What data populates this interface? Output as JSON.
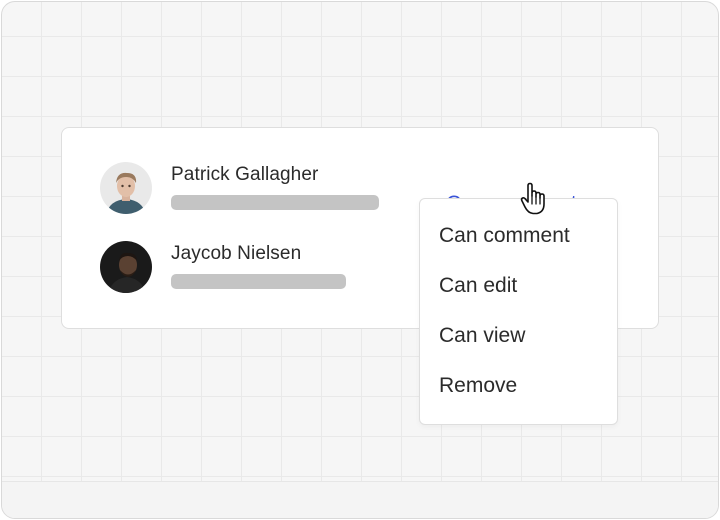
{
  "share_panel": {
    "members": [
      {
        "name": "Patrick Gallagher",
        "permission": "Can comment"
      },
      {
        "name": "Jaycob Nielsen"
      }
    ]
  },
  "permission_menu": {
    "options": [
      "Can comment",
      "Can edit",
      "Can view",
      "Remove"
    ]
  },
  "colors": {
    "accent": "#3b55d9",
    "text": "#2b2b2b",
    "placeholder": "#c4c4c4"
  },
  "icons": [
    "chevron-down-icon",
    "hand-pointer-cursor-icon"
  ]
}
